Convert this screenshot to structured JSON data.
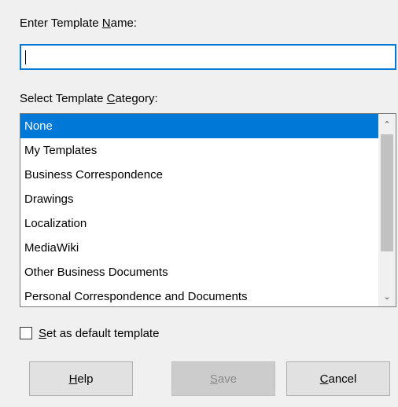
{
  "dialog": {
    "name_label": "Enter Template Name:",
    "name_value": "",
    "category_label": "Select Template Category:",
    "categories": [
      "None",
      "My Templates",
      "Business Correspondence",
      "Drawings",
      "Localization",
      "MediaWiki",
      "Other Business Documents",
      "Personal Correspondence and Documents"
    ],
    "selected_category": "None",
    "default_template_label": "Set as default template",
    "default_template_checked": false,
    "buttons": {
      "help": "Help",
      "save": "Save",
      "cancel": "Cancel"
    }
  },
  "icons": {
    "scroll_up": "chevron-up-icon",
    "scroll_down": "chevron-down-icon"
  },
  "colors": {
    "selection": "#0078d7",
    "input_focus_border": "#0078d7",
    "background": "#f0f0f0"
  }
}
